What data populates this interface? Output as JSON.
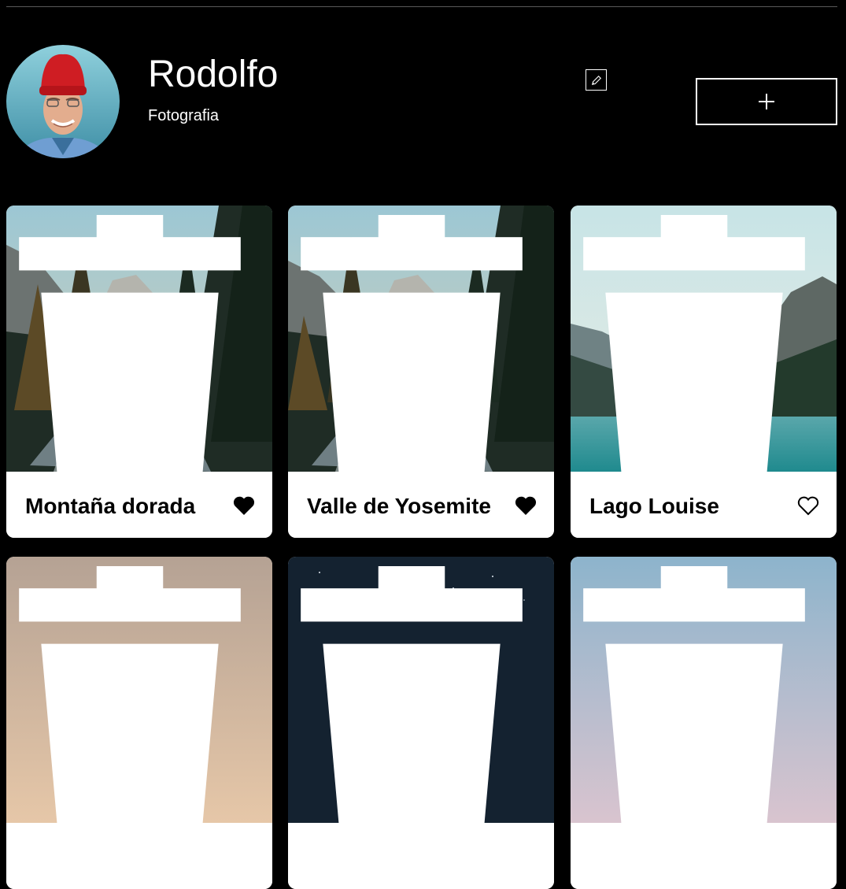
{
  "profile": {
    "name": "Rodolfo",
    "subtitle": "Fotografia"
  },
  "actions": {
    "edit_icon": "pencil-icon",
    "add_label": "+"
  },
  "cards": [
    {
      "title": "Montaña dorada",
      "liked": true
    },
    {
      "title": "Valle de Yosemite",
      "liked": true
    },
    {
      "title": "Lago Louise",
      "liked": false
    },
    {
      "title": "",
      "liked": false
    },
    {
      "title": "",
      "liked": false
    },
    {
      "title": "",
      "liked": false
    }
  ],
  "colors": {
    "background": "#000000",
    "card": "#ffffff",
    "text_dark": "#000000"
  }
}
